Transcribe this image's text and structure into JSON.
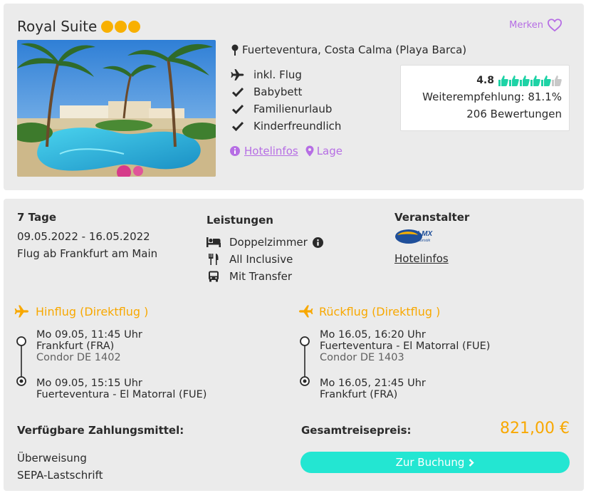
{
  "hotel": {
    "name": "Royal Suite",
    "stars": 3,
    "merken_label": "Merken",
    "location": "Fuerteventura, Costa Calma (Playa Barca)",
    "features": [
      "inkl. Flug",
      "Babybett",
      "Familienurlaub",
      "Kinderfreundlich"
    ],
    "feature_icons": [
      "plane-icon",
      "check-icon",
      "check-icon",
      "check-icon"
    ],
    "hotelinfos_label": "Hotelinfos",
    "lage_label": "Lage"
  },
  "rating": {
    "score": "4.8",
    "thumbs_filled": 5,
    "thumbs_total": 6,
    "recommendation": "Weiterempfehlung: 81.1%",
    "reviews": "206 Bewertungen"
  },
  "trip": {
    "duration": "7 Tage",
    "dates": "09.05.2022 - 16.05.2022",
    "departure": "Flug ab Frankfurt am Main"
  },
  "services": {
    "title": "Leistungen",
    "items": [
      "Doppelzimmer",
      "All Inclusive",
      "Mit Transfer"
    ],
    "icons": [
      "bed-icon",
      "cutlery-icon",
      "bus-icon"
    ]
  },
  "operator": {
    "title": "Veranstalter",
    "logo_text": "LMX",
    "logo_sub": "Touristik",
    "link_label": "Hotelinfos"
  },
  "outbound": {
    "title": "Hinflug (Direktflug )",
    "dep_time": "Mo 09.05, 11:45 Uhr",
    "dep_airport": "Frankfurt (FRA)",
    "carrier": "Condor DE 1402",
    "arr_time": "Mo 09.05, 15:15 Uhr",
    "arr_airport": "Fuerteventura - El Matorral (FUE)"
  },
  "return": {
    "title": "Rückflug (Direktflug )",
    "dep_time": "Mo 16.05, 16:20 Uhr",
    "dep_airport": "Fuerteventura - El Matorral (FUE)",
    "carrier": "Condor DE 1403",
    "arr_time": "Mo 16.05, 21:45 Uhr",
    "arr_airport": "Frankfurt (FRA)"
  },
  "payment": {
    "title": "Verfügbare Zahlungsmittel:",
    "methods": [
      "Überweisung",
      "SEPA-Lastschrift"
    ]
  },
  "total": {
    "label": "Gesamtreisepreis:",
    "price": "821,00 €"
  },
  "booking": {
    "button_label": "Zur Buchung"
  },
  "colors": {
    "accent_orange": "#f8a800",
    "star_yellow": "#f8b000",
    "link_purple": "#b66ee4",
    "button_teal": "#23e6d2",
    "thumb_teal": "#1ed3a6",
    "card_bg": "#ebebeb"
  }
}
